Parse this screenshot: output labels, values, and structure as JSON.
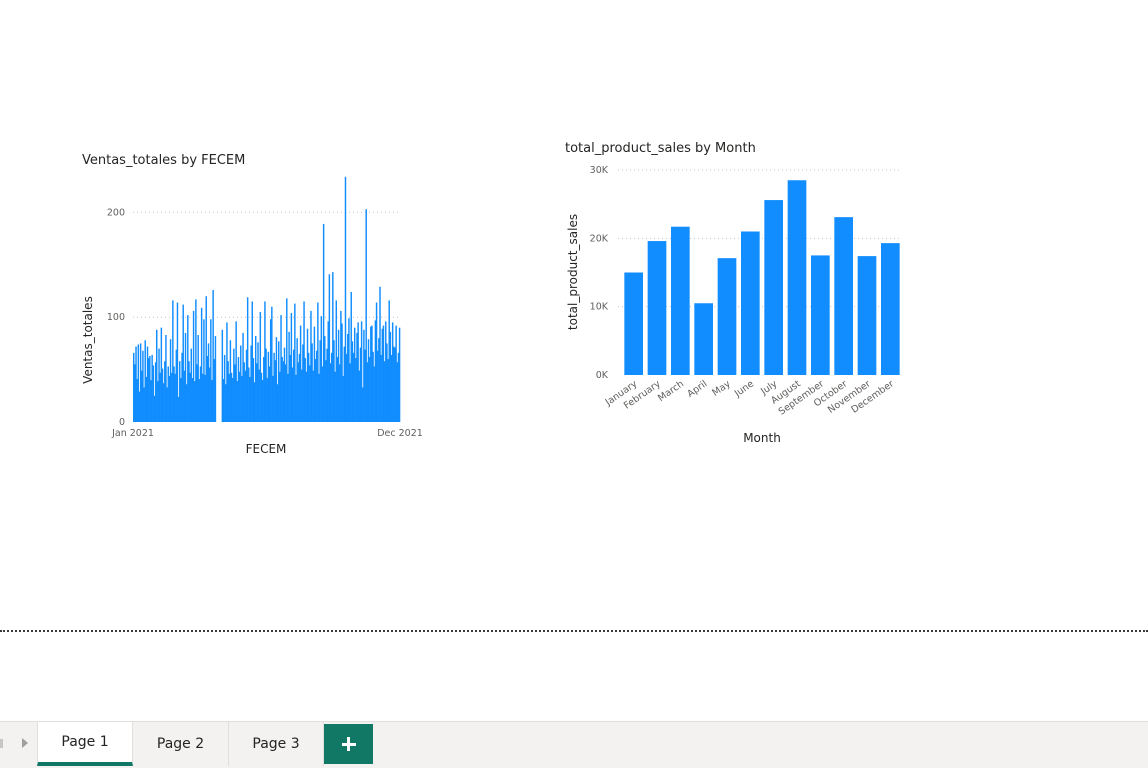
{
  "colors": {
    "bar": "#118dff",
    "accent": "#117865"
  },
  "chart_data": [
    {
      "type": "bar",
      "title": "Ventas_totales by FECEM",
      "xlabel": "FECEM",
      "ylabel": "Ventas_totales",
      "x_tick_labels": [
        "Jan 2021",
        "Dec 2021"
      ],
      "ylim": [
        0,
        250
      ],
      "y_ticks": [
        0,
        100,
        200
      ],
      "grid": true,
      "values": [
        66,
        55,
        72,
        41,
        74,
        29,
        75,
        49,
        68,
        33,
        78,
        43,
        72,
        61,
        63,
        40,
        64,
        54,
        25,
        57,
        88,
        39,
        70,
        47,
        90,
        51,
        37,
        58,
        83,
        33,
        53,
        44,
        79,
        47,
        116,
        53,
        46,
        69,
        114,
        24,
        58,
        42,
        66,
        112,
        49,
        85,
        36,
        102,
        58,
        47,
        70,
        42,
        106,
        39,
        117,
        55,
        83,
        41,
        53,
        109,
        46,
        98,
        45,
        120,
        63,
        75,
        52,
        98,
        40,
        126,
        60,
        82,
        0,
        0,
        0,
        0,
        0,
        88,
        41,
        64,
        36,
        95,
        58,
        46,
        78,
        47,
        42,
        70,
        55,
        96,
        39,
        62,
        48,
        73,
        44,
        85,
        57,
        49,
        69,
        119,
        52,
        43,
        73,
        115,
        61,
        38,
        82,
        56,
        76,
        50,
        105,
        47,
        40,
        62,
        115,
        70,
        42,
        67,
        53,
        98,
        110,
        44,
        66,
        59,
        81,
        36,
        77,
        48,
        102,
        62,
        58,
        71,
        55,
        118,
        46,
        86,
        64,
        104,
        52,
        69,
        113,
        45,
        80,
        57,
        65,
        92,
        50,
        74,
        115,
        61,
        48,
        89,
        66,
        54,
        106,
        75,
        49,
        91,
        60,
        68,
        114,
        46,
        78,
        101,
        53,
        189,
        82,
        59,
        70,
        96,
        141,
        56,
        66,
        143,
        78,
        48,
        116,
        62,
        88,
        55,
        106,
        94,
        44,
        72,
        234,
        65,
        84,
        99,
        56,
        124,
        77,
        66,
        90,
        61,
        85,
        95,
        49,
        71,
        96,
        33,
        88,
        69,
        203,
        57,
        79,
        62,
        91,
        92,
        67,
        53,
        97,
        114,
        68,
        80,
        129,
        64,
        89,
        92,
        58,
        96,
        75,
        60,
        116,
        86,
        64,
        95,
        72,
        71,
        92,
        57,
        66,
        90
      ]
    },
    {
      "type": "bar",
      "title": "total_product_sales by Month",
      "xlabel": "Month",
      "ylabel": "total_product_sales",
      "categories": [
        "January",
        "February",
        "March",
        "April",
        "May",
        "June",
        "July",
        "August",
        "September",
        "October",
        "November",
        "December"
      ],
      "values": [
        15000,
        19600,
        21700,
        10500,
        17100,
        21000,
        25600,
        28500,
        17500,
        23100,
        17400,
        19300
      ],
      "ylim": [
        0,
        30000
      ],
      "y_tick_labels": [
        "0K",
        "10K",
        "20K",
        "30K"
      ],
      "grid": true
    }
  ],
  "tabs": [
    {
      "label": "Page 1",
      "active": true
    },
    {
      "label": "Page 2",
      "active": false
    },
    {
      "label": "Page 3",
      "active": false
    }
  ],
  "add_page_icon": "plus-icon"
}
